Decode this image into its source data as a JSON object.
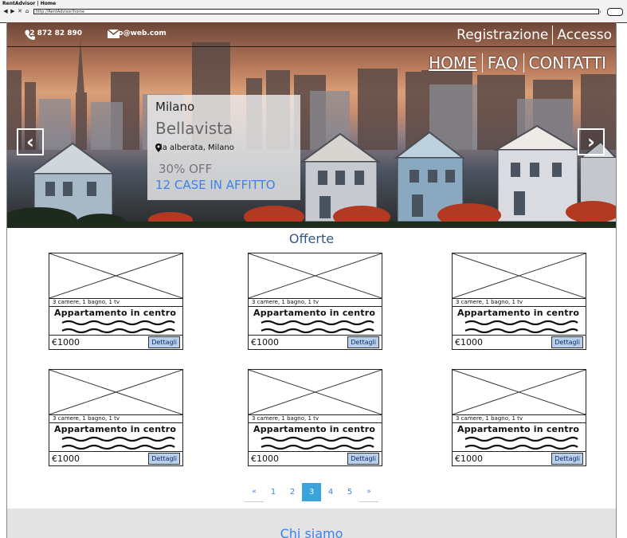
{
  "window": {
    "title": "RentAdvisor | Home",
    "url": "http://RentAdvisor/home"
  },
  "header": {
    "phone": "02 872 82 890",
    "email": "info@web.com",
    "auth": [
      "Registrazione",
      "Accesso"
    ],
    "nav": [
      "HOME",
      "FAQ",
      "CONTATTI"
    ]
  },
  "hero": {
    "city": "Milano",
    "name": "Bellavista",
    "address": "via alberata, Milano",
    "discount": "30% OFF",
    "count": "12 CASE IN AFFITTO"
  },
  "offers": {
    "title": "Offerte",
    "cards": [
      {
        "meta": "3 camere, 1 bagno, 1 tv",
        "title": "Appartamento in centro",
        "price": "€1000",
        "button": "Dettagli"
      },
      {
        "meta": "3 camere, 1 bagno, 1 tv",
        "title": "Appartamento in centro",
        "price": "€1000",
        "button": "Dettagli"
      },
      {
        "meta": "3 camere, 1 bagno, 1 tv",
        "title": "Appartamento in centro",
        "price": "€1000",
        "button": "Dettagli"
      },
      {
        "meta": "3 camere, 1 bagno, 1 tv",
        "title": "Appartamento in centro",
        "price": "€1000",
        "button": "Dettagli"
      },
      {
        "meta": "3 camere, 1 bagno, 1 tv",
        "title": "Appartamento in centro",
        "price": "€1000",
        "button": "Dettagli"
      },
      {
        "meta": "3 camere, 1 bagno, 1 tv",
        "title": "Appartamento in centro",
        "price": "€1000",
        "button": "Dettagli"
      }
    ]
  },
  "pagination": {
    "prev": "«",
    "pages": [
      "1",
      "2",
      "3",
      "4",
      "5"
    ],
    "current": "3",
    "next": "»"
  },
  "about": {
    "title": "Chi siamo"
  },
  "colors": {
    "accent_blue": "#3c82ee",
    "section_title": "#34577f",
    "active_page": "#3aa3dc",
    "button_bg": "#b8d0ee"
  }
}
